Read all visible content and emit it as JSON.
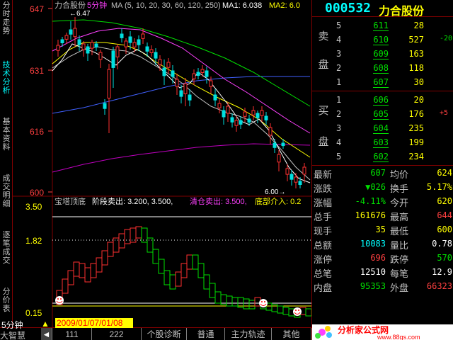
{
  "left_tabs": [
    "分时走势",
    "技术分析",
    "基本资料",
    "成交明细",
    "逐笔成交",
    "分价表"
  ],
  "kline": {
    "title": "力合股份",
    "period_tag": "5分钟",
    "ma_params": "MA (5, 10, 20, 30, 60, 120, 250)",
    "ma1": "MA1: 6.038",
    "ma2": "MA2: 6.0",
    "price_labels": [
      "647",
      "631",
      "616",
      "600"
    ],
    "high_mark": "6.47",
    "low_mark": "6.00"
  },
  "indicator": {
    "line": "宝塔顶底 阶段卖出: 3.200, 3.500, 清仓卖出: 3.500, 底部介入: 0.2",
    "name": "宝塔顶底",
    "stage_sell": "阶段卖出: 3.200, 3.500,",
    "clear_sell": "清仓卖出: 3.500,",
    "bottom_buy": "底部介入: 0.2",
    "y_labels": [
      "3.50",
      "1.82",
      "0.15"
    ]
  },
  "bottom": {
    "period": "5分钟",
    "date_range": "2009/01/07/01/08",
    "app": "大智慧",
    "tabs": [
      "111",
      "222",
      "个股诊断",
      "普通",
      "主力轨迹",
      "其他"
    ]
  },
  "quote": {
    "code": "000532",
    "name": "力合股份",
    "sell_label_1": "卖",
    "sell_label_2": "盘",
    "buy_label_1": "买",
    "buy_label_2": "盘",
    "asks": [
      {
        "level": "5",
        "price": "611",
        "volume": "28",
        "change": ""
      },
      {
        "level": "4",
        "price": "610",
        "volume": "527",
        "change": "-20"
      },
      {
        "level": "3",
        "price": "609",
        "volume": "163",
        "change": ""
      },
      {
        "level": "2",
        "price": "608",
        "volume": "118",
        "change": ""
      },
      {
        "level": "1",
        "price": "607",
        "volume": "30",
        "change": ""
      }
    ],
    "bids": [
      {
        "level": "1",
        "price": "606",
        "volume": "20",
        "change": ""
      },
      {
        "level": "2",
        "price": "605",
        "volume": "176",
        "change": "+5"
      },
      {
        "level": "3",
        "price": "604",
        "volume": "235",
        "change": ""
      },
      {
        "level": "4",
        "price": "603",
        "volume": "199",
        "change": ""
      },
      {
        "level": "5",
        "price": "602",
        "volume": "234",
        "change": ""
      }
    ],
    "stats": [
      {
        "k1": "最新",
        "v1": "607",
        "c1": "#00e000",
        "k2": "均价",
        "v2": "624",
        "c2": "#ffff00"
      },
      {
        "k1": "涨跌",
        "v1": "▼026",
        "c1": "#00e000",
        "k2": "换手",
        "v2": "5.17%",
        "c2": "#ffff00"
      },
      {
        "k1": "涨幅",
        "v1": "-4.11%",
        "c1": "#00e000",
        "k2": "今开",
        "v2": "620",
        "c2": "#ffff00"
      },
      {
        "k1": "总手",
        "v1": "161676",
        "c1": "#ffff00",
        "k2": "最高",
        "v2": "644",
        "c2": "#ff4040"
      },
      {
        "k1": "现手",
        "v1": "35",
        "c1": "#ffff00",
        "k2": "最低",
        "v2": "600",
        "c2": "#ffff00"
      },
      {
        "k1": "总额",
        "v1": "10083",
        "c1": "#00ffff",
        "k2": "量比",
        "v2": "0.78",
        "c2": "#ffffff"
      },
      {
        "k1": "涨停",
        "v1": "696",
        "c1": "#ff4040",
        "k2": "跌停",
        "v2": "570",
        "c2": "#00e000"
      },
      {
        "k1": "总笔",
        "v1": "12510",
        "c1": "#ffffff",
        "k2": "每笔",
        "v2": "12.9",
        "c2": "#ffffff"
      },
      {
        "k1": "内盘",
        "v1": "95353",
        "c1": "#00e000",
        "k2": "外盘",
        "v2": "66323",
        "c2": "#ff4040"
      }
    ]
  },
  "logo": {
    "text": "分析家公式网",
    "url": "www.88gs.com"
  },
  "colors": {
    "up": "#ff3030",
    "down": "#00e0e0",
    "ma_white": "#ffffff",
    "ma_yellow": "#ffff00",
    "ma_magenta": "#ff40ff",
    "ma_green": "#00e000",
    "ma_blue": "#4060ff",
    "ma_purple": "#c000c0",
    "frame": "#800000"
  }
}
